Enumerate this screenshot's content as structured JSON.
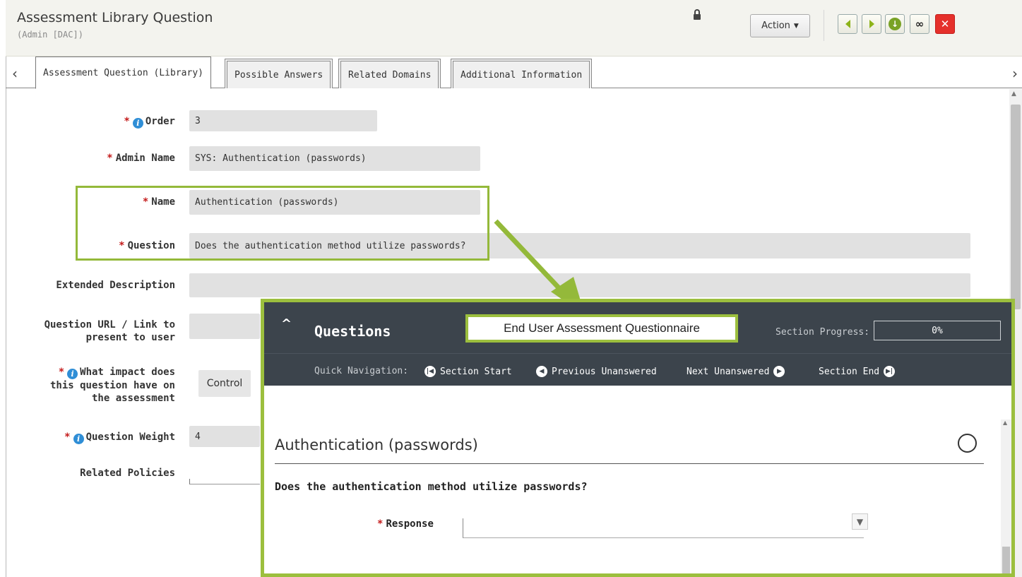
{
  "header": {
    "title": "Assessment Library Question",
    "subtitle": "(Admin [DAC])",
    "action_label": "Action",
    "toolbar_icons": [
      "lock-icon",
      "previous-icon",
      "next-icon",
      "download-icon",
      "link-icon",
      "close-icon"
    ]
  },
  "tabs": [
    {
      "label": "Assessment Question (Library)"
    },
    {
      "label": "Possible Answers"
    },
    {
      "label": "Related Domains"
    },
    {
      "label": "Additional Information"
    }
  ],
  "form": {
    "order": {
      "label": "Order",
      "value": "3"
    },
    "admin_name": {
      "label": "Admin Name",
      "value": "SYS: Authentication (passwords)"
    },
    "name": {
      "label": "Name",
      "value": "Authentication (passwords)"
    },
    "question": {
      "label": "Question",
      "value": "Does the authentication method utilize passwords?"
    },
    "extended_description": {
      "label": "Extended Description",
      "value": ""
    },
    "question_url": {
      "label_line1": "Question URL / Link to",
      "label_line2": "present to user",
      "value": ""
    },
    "impact": {
      "label_line1": "What impact does",
      "label_line2": "this question have on",
      "label_line3": "the assessment",
      "value": "Control"
    },
    "weight": {
      "label": "Question Weight",
      "value": "4"
    },
    "related_policies": {
      "label": "Related Policies"
    }
  },
  "overlay": {
    "title": "Questions",
    "questionnaire_name": "End User Assessment Questionnaire",
    "section_progress_label": "Section Progress:",
    "section_progress_value": "0%",
    "section_progress_fraction": 0,
    "quick_nav_label": "Quick Navigation:",
    "nav": {
      "section_start": "Section Start",
      "previous_unanswered": "Previous Unanswered",
      "next_unanswered": "Next Unanswered",
      "section_end": "Section End"
    },
    "section_title": "Authentication (passwords)",
    "question_text": "Does the authentication method utilize passwords?",
    "response_label": "Response"
  },
  "colors": {
    "accent_green": "#9cbf3e",
    "required_red": "#c41b1b",
    "info_blue": "#2f8ed6",
    "dark_panel": "#3c444c",
    "close_red": "#e5302b"
  }
}
